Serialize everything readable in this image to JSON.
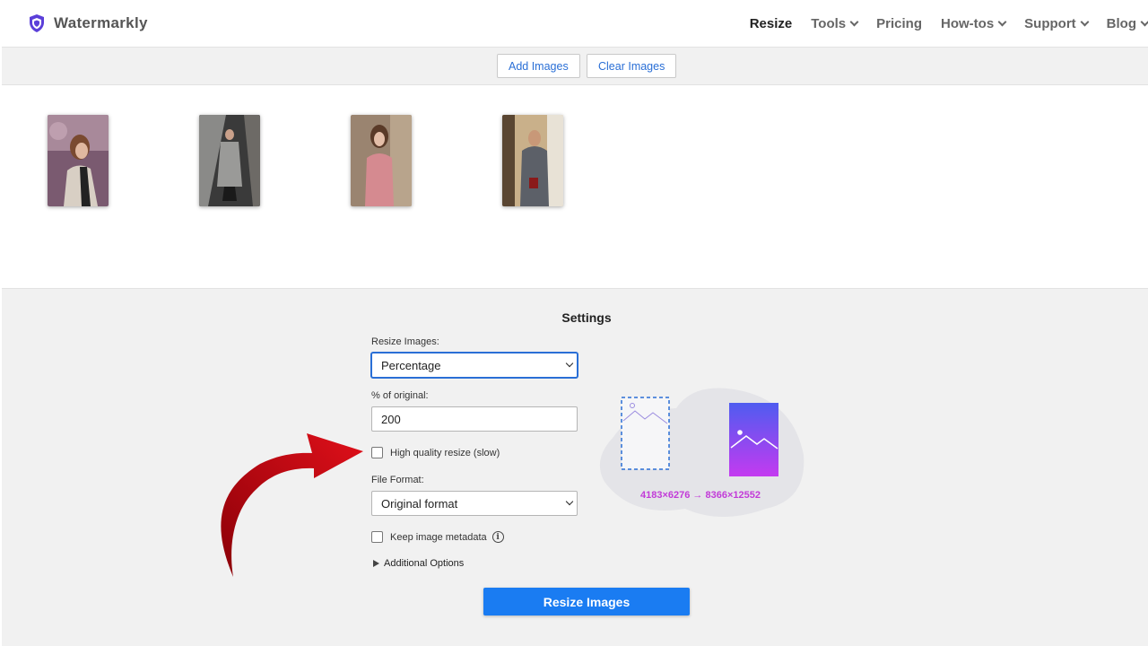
{
  "header": {
    "brand": "Watermarkly",
    "nav": [
      {
        "label": "Resize",
        "has_dropdown": false,
        "active": true
      },
      {
        "label": "Tools",
        "has_dropdown": true
      },
      {
        "label": "Pricing",
        "has_dropdown": false
      },
      {
        "label": "How-tos",
        "has_dropdown": true
      },
      {
        "label": "Support",
        "has_dropdown": true
      },
      {
        "label": "Blog",
        "has_dropdown": true
      }
    ]
  },
  "toolbar": {
    "add_images": "Add Images",
    "clear_images": "Clear Images"
  },
  "gallery": {
    "thumbnail_count": 4
  },
  "settings": {
    "title": "Settings",
    "resize_label": "Resize Images:",
    "resize_value": "Percentage",
    "percent_label": "% of original:",
    "percent_value": "200",
    "high_quality_label": "High quality resize (slow)",
    "high_quality_checked": false,
    "file_format_label": "File Format:",
    "file_format_value": "Original format",
    "keep_metadata_label": "Keep image metadata",
    "keep_metadata_checked": false,
    "additional_options_label": "Additional Options",
    "submit_label": "Resize Images",
    "dimension_preview": "4183×6276 → 8366×12552"
  },
  "colors": {
    "accent": "#1a7cf2",
    "link": "#2a6fd6",
    "brand_shield": "#5b3fd9",
    "preview_text": "#c23bd8",
    "annotation_arrow": "#c0000c"
  }
}
